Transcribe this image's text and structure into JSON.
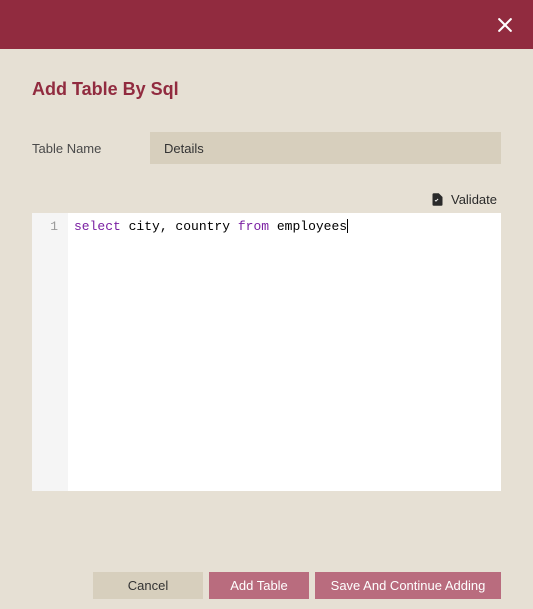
{
  "header": {
    "title": "Add Table By Sql"
  },
  "form": {
    "table_name_label": "Table Name",
    "table_name_value": "Details"
  },
  "editor": {
    "validate_label": "Validate",
    "line_numbers": [
      "1"
    ],
    "sql_tokens": [
      {
        "t": "select",
        "kw": true
      },
      {
        "t": " city, country ",
        "kw": false
      },
      {
        "t": "from",
        "kw": true
      },
      {
        "t": " employees",
        "kw": false
      }
    ],
    "sql_plain": "select city, country from employees"
  },
  "buttons": {
    "cancel": "Cancel",
    "add_table": "Add Table",
    "save_continue": "Save And Continue Adding"
  }
}
